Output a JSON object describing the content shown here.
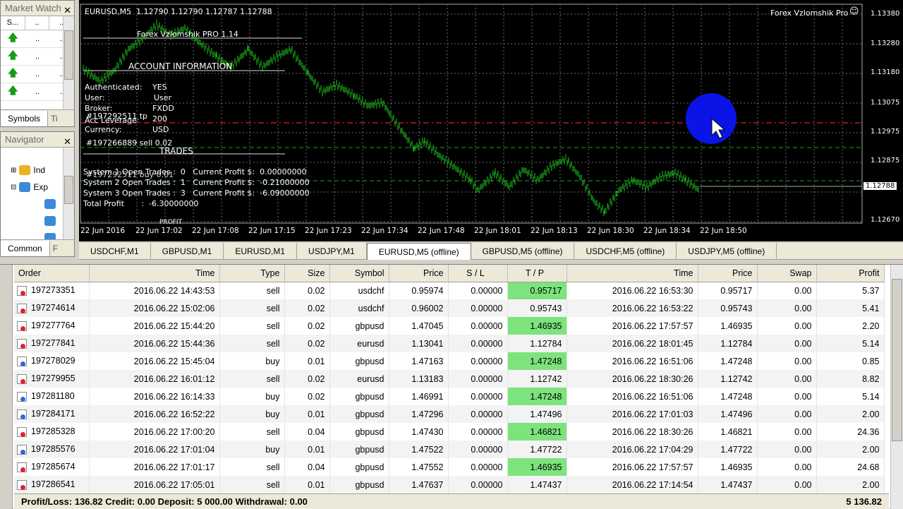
{
  "market_watch": {
    "title": "Market Watch",
    "headers": [
      "S...",
      "..",
      ".."
    ],
    "rows": [
      [
        "..",
        ".."
      ],
      [
        "..",
        ".."
      ],
      [
        "..",
        ".."
      ],
      [
        "..",
        ".."
      ]
    ],
    "tabs": [
      "Symbols",
      "Ti"
    ]
  },
  "navigator": {
    "title": "Navigator",
    "items": [
      "Ind",
      "Exp"
    ],
    "tabs": [
      "Common",
      "F"
    ]
  },
  "chart": {
    "header": "EURUSD,M5  1.12790 1.12790 1.12787 1.12788",
    "ea_name": "Forex Vzlomshik Pro",
    "ea_title": "Forex Vzlomshik PRO 1.14",
    "account_info_label": "ACCOUNT INFORMATION",
    "authenticated_label": "Authenticated:",
    "authenticated_value": "YES",
    "user_label": "User:",
    "user_value": "User",
    "broker_label": "Broker:",
    "broker_value": "FXDD",
    "leverage_label": "Acc Leverage:",
    "leverage_value": "200",
    "currency_label": "Currency:",
    "currency_value": "USD",
    "order_tp_label": "#197292511 tp",
    "order_sell_label": "#197266889 sell 0.02",
    "trades_label": "TRADES",
    "buy_overlay": "#197292511 buy 0.01",
    "system1": "System 1 Open Trades :  0   Current Profit $:  0.00000000",
    "system2": "System 2 Open Trades :  1   Current Profit $:  -0.21000000",
    "system3": "System 3 Open Trades :  3   Current Profit $:  -6.09000000",
    "total_profit": "Total Profit       :  -6.30000000",
    "profit_label": "PROFIT",
    "price_labels": [
      "1.13380",
      "1.13280",
      "1.13180",
      "1.13075",
      "1.12975",
      "1.12875",
      "1.12788",
      "1.12670"
    ],
    "current_price": "1.12788",
    "time_labels": [
      "22 Jun 2016",
      "22 Jun 17:02",
      "22 Jun 17:08",
      "22 Jun 17:15",
      "22 Jun 17:23",
      "22 Jun 17:34",
      "22 Jun 17:48",
      "22 Jun 18:01",
      "22 Jun 18:13",
      "22 Jun 18:30",
      "22 Jun 18:34",
      "22 Jun 18:50"
    ],
    "colors": {
      "bars": "#1fd11f",
      "grid": "#6d6d6d",
      "sell_line": "#e02020",
      "tp_line": "#20a020",
      "cursor_circle": "#0a14e6"
    }
  },
  "chart_tabs": [
    "USDCHF,M1",
    "GBPUSD,M1",
    "EURUSD,M1",
    "USDJPY,M1",
    "EURUSD,M5 (offline)",
    "GBPUSD,M5 (offline)",
    "USDCHF,M5 (offline)",
    "USDJPY,M5 (offline)"
  ],
  "chart_tab_active": 4,
  "terminal": {
    "columns": [
      "Order",
      "Time",
      "Type",
      "Size",
      "Symbol",
      "Price",
      "S / L",
      "T / P",
      "Time",
      "Price",
      "Swap",
      "Profit"
    ],
    "rows": [
      [
        "197273351",
        "2016.06.22 14:43:53",
        "sell",
        "0.02",
        "usdchf",
        "0.95974",
        "0.00000",
        "0.95717",
        "2016.06.22 16:53:30",
        "0.95717",
        "0.00",
        "5.37"
      ],
      [
        "197274614",
        "2016.06.22 15:02:06",
        "sell",
        "0.02",
        "usdchf",
        "0.96002",
        "0.00000",
        "0.95743",
        "2016.06.22 16:53:22",
        "0.95743",
        "0.00",
        "5.41"
      ],
      [
        "197277764",
        "2016.06.22 15:44:20",
        "sell",
        "0.02",
        "gbpusd",
        "1.47045",
        "0.00000",
        "1.46935",
        "2016.06.22 17:57:57",
        "1.46935",
        "0.00",
        "2.20"
      ],
      [
        "197277841",
        "2016.06.22 15:44:36",
        "sell",
        "0.02",
        "eurusd",
        "1.13041",
        "0.00000",
        "1.12784",
        "2016.06.22 18:01:45",
        "1.12784",
        "0.00",
        "5.14"
      ],
      [
        "197278029",
        "2016.06.22 15:45:04",
        "buy",
        "0.01",
        "gbpusd",
        "1.47163",
        "0.00000",
        "1.47248",
        "2016.06.22 16:51:06",
        "1.47248",
        "0.00",
        "0.85"
      ],
      [
        "197279955",
        "2016.06.22 16:01:12",
        "sell",
        "0.02",
        "eurusd",
        "1.13183",
        "0.00000",
        "1.12742",
        "2016.06.22 18:30:26",
        "1.12742",
        "0.00",
        "8.82"
      ],
      [
        "197281180",
        "2016.06.22 16:14:33",
        "buy",
        "0.02",
        "gbpusd",
        "1.46991",
        "0.00000",
        "1.47248",
        "2016.06.22 16:51:06",
        "1.47248",
        "0.00",
        "5.14"
      ],
      [
        "197284171",
        "2016.06.22 16:52:22",
        "buy",
        "0.01",
        "gbpusd",
        "1.47296",
        "0.00000",
        "1.47496",
        "2016.06.22 17:01:03",
        "1.47496",
        "0.00",
        "2.00"
      ],
      [
        "197285328",
        "2016.06.22 17:00:20",
        "sell",
        "0.04",
        "gbpusd",
        "1.47430",
        "0.00000",
        "1.46821",
        "2016.06.22 18:30:26",
        "1.46821",
        "0.00",
        "24.36"
      ],
      [
        "197285576",
        "2016.06.22 17:01:04",
        "buy",
        "0.01",
        "gbpusd",
        "1.47522",
        "0.00000",
        "1.47722",
        "2016.06.22 17:04:29",
        "1.47722",
        "0.00",
        "2.00"
      ],
      [
        "197285674",
        "2016.06.22 17:01:17",
        "sell",
        "0.04",
        "gbpusd",
        "1.47552",
        "0.00000",
        "1.46935",
        "2016.06.22 17:57:57",
        "1.46935",
        "0.00",
        "24.68"
      ],
      [
        "197286541",
        "2016.06.22 17:05:01",
        "sell",
        "0.01",
        "gbpusd",
        "1.47637",
        "0.00000",
        "1.47437",
        "2016.06.22 17:14:54",
        "1.47437",
        "0.00",
        "2.00"
      ]
    ],
    "summary": "Profit/Loss: 136.82  Credit: 0.00  Deposit: 5 000.00  Withdrawal: 0.00",
    "summary_total": "5 136.82"
  }
}
